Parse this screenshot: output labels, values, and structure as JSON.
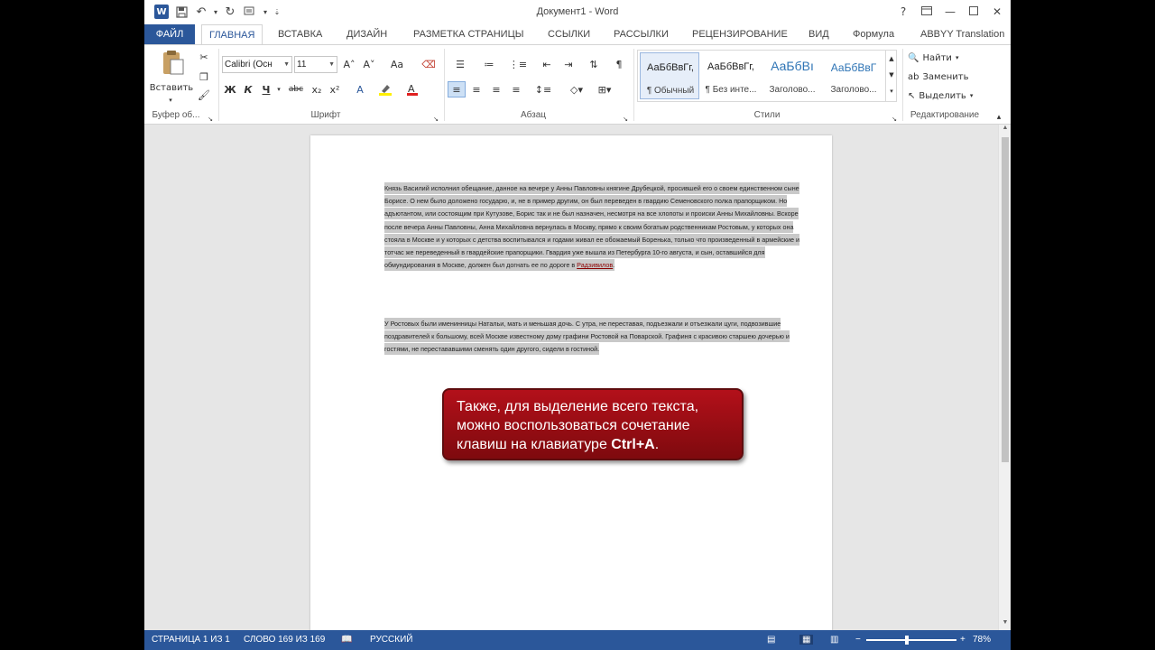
{
  "window": {
    "title": "Документ1 - Word",
    "help_icon": "?"
  },
  "tabs": [
    "ФАЙЛ",
    "ГЛАВНАЯ",
    "ВСТАВКА",
    "ДИЗАЙН",
    "РАЗМЕТКА СТРАНИЦЫ",
    "ССЫЛКИ",
    "РАССЫЛКИ",
    "РЕЦЕНЗИРОВАНИЕ",
    "ВИД",
    "Формула",
    "ABBYY Translation"
  ],
  "ribbon": {
    "clipboard": {
      "paste_label": "Вставить",
      "group_label": "Буфер об..."
    },
    "font": {
      "font_name": "Calibri (Осн",
      "font_size": "11",
      "grow": "A˄",
      "shrink": "A˅",
      "case": "Aa",
      "bold": "Ж",
      "italic": "К",
      "underline": "Ч",
      "strike": "abc",
      "subscript": "x₂",
      "superscript": "x²",
      "group_label": "Шрифт"
    },
    "paragraph": {
      "group_label": "Абзац",
      "pilcrow": "¶"
    },
    "styles": {
      "items": [
        {
          "sample": "АаБбВвГг,",
          "name": "¶ Обычный"
        },
        {
          "sample": "АаБбВвГг,",
          "name": "¶ Без инте..."
        },
        {
          "sample": "АаБбВı",
          "name": "Заголово..."
        },
        {
          "sample": "АаБбВвГ",
          "name": "Заголово..."
        }
      ],
      "group_label": "Стили"
    },
    "editing": {
      "find": "Найти",
      "replace": "Заменить",
      "select": "Выделить",
      "group_label": "Редактирование"
    }
  },
  "document": {
    "paragraph1": "Князь Василий исполнил обещание, данное на вечере у Анны Павловны княгине Друбецкой, просившей его о своем единственном сыне Борисе. О нем было доложено государю, и, не в пример другим, он был переведен в гвардию Семеновского полка прапорщиком. Но адъютантом, или состоящим при Кутузове, Борис так и не был назначен, несмотря на все хлопоты и происки Анны Михайловны. Вскоре после вечера Анны Павловны, Анна Михайловна вернулась в Москву, прямо к своим богатым родственникам Ростовым, у которых она стояла в Москве и у которых с детства воспитывался и годами живал ее обожаемый Боренька, только что произведенный в армейские и тотчас же переведенный в гвардейские прапорщики. Гвардия уже вышла из Петербурга 10-го августа, и сын, оставшийся для обмундирования в Москве, должен был догнать ее по дороге в",
    "paragraph1_link": "Радзивилов",
    "paragraph1_end": ".",
    "paragraph2": "У Ростовых были именинницы Натальи, мать и меньшая дочь. С утра, не переставая, подъезжали и отъезжали цуги, подвозившие поздравителей к большому, всей Москве известному дому графини Ростовой на Поварской. Графиня с красивою старшею дочерью и гостями, не перестававшими сменять один другого, сидели в гостиной."
  },
  "callout": {
    "text": "Также, для выделение всего текста, можно воспользоваться сочетание клавиш на клавиатуре ",
    "bold": "Ctrl+A",
    "end": "."
  },
  "status": {
    "page": "СТРАНИЦА 1 ИЗ 1",
    "words": "СЛОВО 169 ИЗ 169",
    "language": "РУССКИЙ",
    "zoom": "78%",
    "zoom_fraction": 0.45
  },
  "colors": {
    "accent": "#2b579a",
    "callout": "#9b0d14",
    "selection": "#c9c9c9"
  }
}
